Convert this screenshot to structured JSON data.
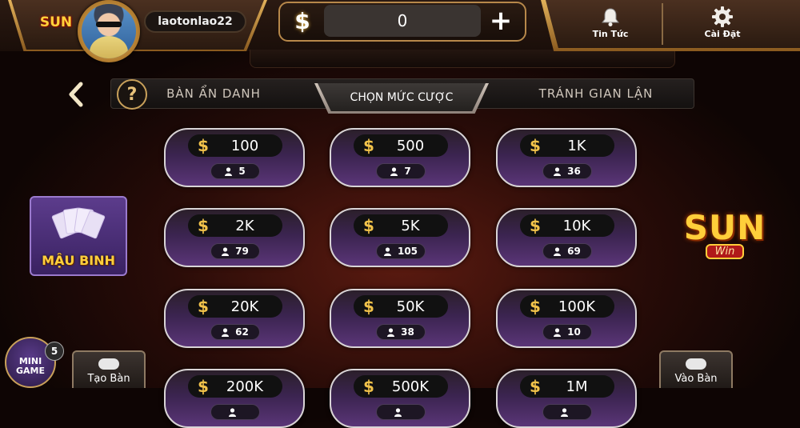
{
  "header": {
    "username": "laotonlao22",
    "coins": "0",
    "coin_symbol": "$",
    "add_symbol": "+",
    "logo_text": "SUN",
    "news_label": "Tin Tức",
    "settings_label": "Cài Đặt"
  },
  "tabs": {
    "help_symbol": "?",
    "anonymous": "BÀN ẨN DANH",
    "choose_bet": "CHỌN MỨC CƯỢC",
    "anti_cheat": "TRÁNH GIAN LẬN"
  },
  "bets": [
    {
      "amount": "100",
      "players": "5"
    },
    {
      "amount": "500",
      "players": "7"
    },
    {
      "amount": "1K",
      "players": "36"
    },
    {
      "amount": "2K",
      "players": "79"
    },
    {
      "amount": "5K",
      "players": "105"
    },
    {
      "amount": "10K",
      "players": "69"
    },
    {
      "amount": "20K",
      "players": "62"
    },
    {
      "amount": "50K",
      "players": "38"
    },
    {
      "amount": "100K",
      "players": "10"
    },
    {
      "amount": "200K",
      "players": ""
    },
    {
      "amount": "500K",
      "players": ""
    },
    {
      "amount": "1M",
      "players": ""
    }
  ],
  "currency_symbol": "$",
  "game": {
    "title": "MẬU BINH"
  },
  "brand": {
    "name": "SUN",
    "sub": "Win"
  },
  "bottom": {
    "mini_game": "MINI GAME",
    "mini_badge": "5",
    "create_table": "Tạo Bàn",
    "join_table": "Vào Bàn"
  },
  "colors": {
    "gold": "#f1c24a",
    "bet_purple": "#5a3577",
    "background": "#2a0c08"
  }
}
